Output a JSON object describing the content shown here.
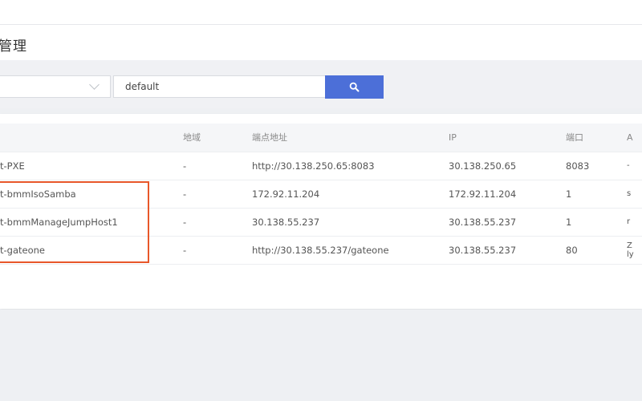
{
  "header": {
    "title": "管理"
  },
  "filter": {
    "select_value": "",
    "search_value": "default",
    "search_icon": "magnifier-icon"
  },
  "table": {
    "headers": [
      "",
      "地域",
      "端点地址",
      "IP",
      "端口",
      "A"
    ],
    "rows": [
      {
        "name": "t-PXE",
        "region": "-",
        "endpoint": "http://30.138.250.65:8083",
        "ip": "30.138.250.65",
        "port": "8083",
        "a": "-"
      },
      {
        "name": "t-bmmIsoSamba",
        "region": "-",
        "endpoint": "172.92.11.204",
        "ip": "172.92.11.204",
        "port": "1",
        "a": "s"
      },
      {
        "name": "t-bmmManageJumpHost1",
        "region": "-",
        "endpoint": "30.138.55.237",
        "ip": "30.138.55.237",
        "port": "1",
        "a": "r"
      },
      {
        "name": "t-gateone",
        "region": "-",
        "endpoint": "http://30.138.55.237/gateone",
        "ip": "30.138.55.237",
        "port": "80",
        "a": "Z\nly"
      }
    ]
  },
  "colors": {
    "primary_button": "#4c6fd8",
    "highlight_border": "#e8572a"
  }
}
